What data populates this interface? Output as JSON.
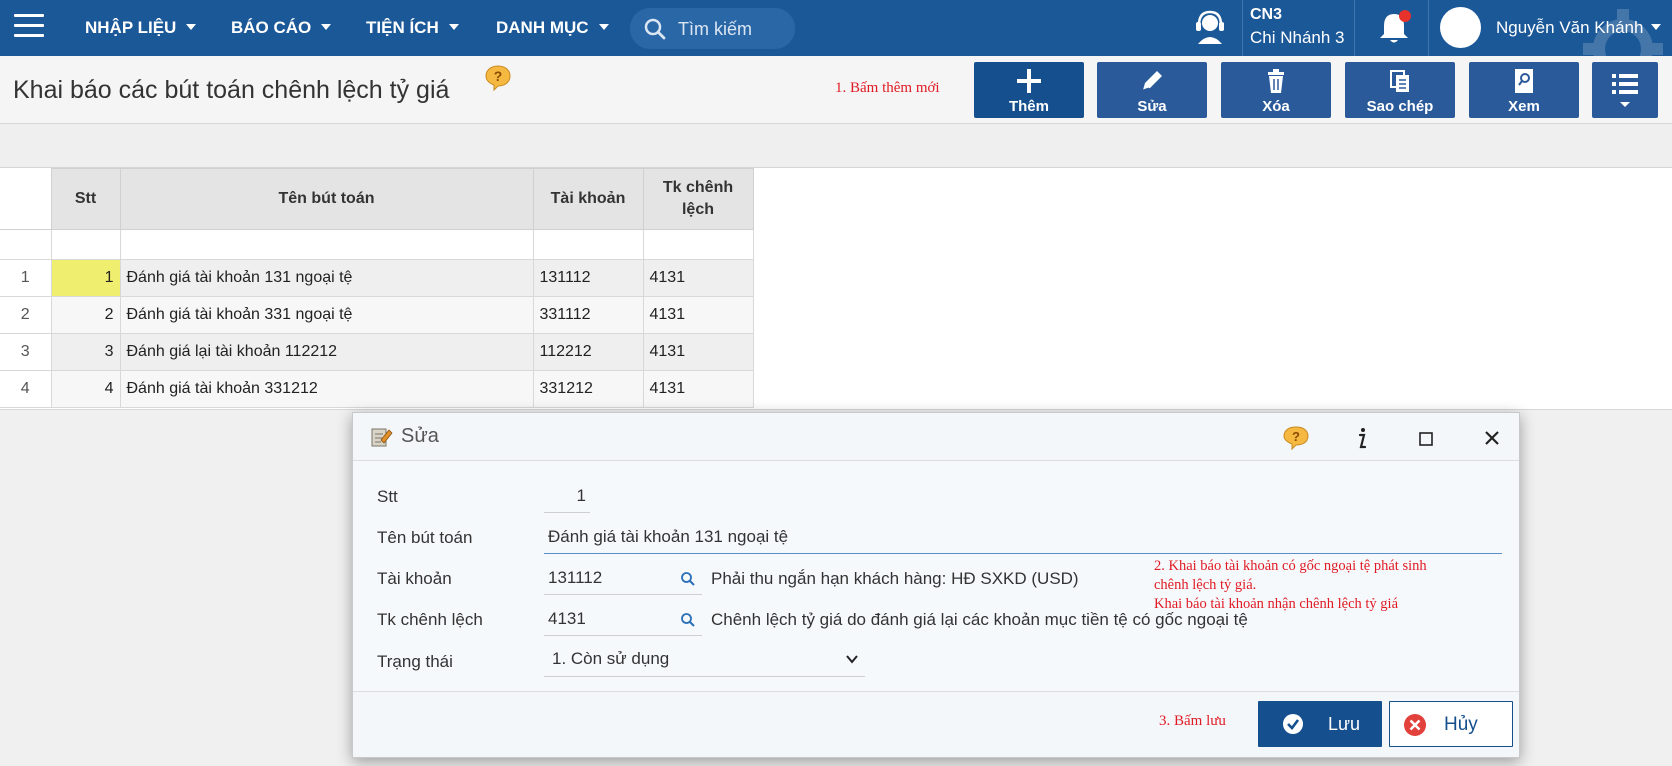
{
  "nav": {
    "menu": [
      {
        "label": "NHẬP LIỆU"
      },
      {
        "label": "BÁO CÁO"
      },
      {
        "label": "TIỆN ÍCH"
      },
      {
        "label": "DANH MỤC"
      }
    ],
    "search_placeholder": "Tìm kiếm",
    "branch_code": "CN3",
    "branch_name": "Chi Nhánh 3",
    "user_name": "Nguyễn Văn Khánh",
    "colors": {
      "bar": "#1b5898",
      "notification_dot": "#e8322c"
    }
  },
  "page": {
    "title": "Khai báo các bút toán chênh lệch tỷ giá"
  },
  "toolbar": {
    "annotation": "1. Bấm thêm mới",
    "add_label": "Thêm",
    "edit_label": "Sửa",
    "delete_label": "Xóa",
    "copy_label": "Sao chép",
    "view_label": "Xem"
  },
  "grid": {
    "headers": {
      "stt": "Stt",
      "name": "Tên bút toán",
      "account": "Tài khoản",
      "diff_account_line1": "Tk chênh",
      "diff_account_line2": "lệch"
    },
    "rows": [
      {
        "rownum": "1",
        "stt": "1",
        "name": "Đánh giá tài khoản 131 ngoại tệ",
        "account": "131112",
        "diff": "4131"
      },
      {
        "rownum": "2",
        "stt": "2",
        "name": "Đánh giá tài khoản 331 ngoại tệ",
        "account": "331112",
        "diff": "4131"
      },
      {
        "rownum": "3",
        "stt": "3",
        "name": "Đánh giá lại tài khoản 112212",
        "account": "112212",
        "diff": "4131"
      },
      {
        "rownum": "4",
        "stt": "4",
        "name": "Đánh giá tài khoản 331212",
        "account": "331212",
        "diff": "4131"
      }
    ],
    "selected_color": "#f0ee6e"
  },
  "dialog": {
    "title": "Sửa",
    "fields": {
      "stt_label": "Stt",
      "stt_value": "1",
      "name_label": "Tên bút toán",
      "name_value": "Đánh giá tài khoản 131 ngoại tệ",
      "account_label": "Tài khoản",
      "account_value": "131112",
      "account_desc": "Phải thu ngắn hạn khách hàng: HĐ SXKD (USD)",
      "diff_label": "Tk chênh lệch",
      "diff_value": "4131",
      "diff_desc": "Chênh lệch tỷ giá do đánh giá lại các khoản mục tiền tệ có gốc ngoại tệ",
      "status_label": "Trạng thái",
      "status_value": "1. Còn sử dụng"
    },
    "annotation_line1": "2. Khai báo tài khoản có gốc ngoại tệ phát sinh",
    "annotation_line2": "chênh lệch tỷ giá.",
    "annotation_line3": "Khai báo tài khoản nhận chênh lệch tỷ giá",
    "save_annotation": "3. Bấm lưu",
    "save_label": "Lưu",
    "cancel_label": "Hủy"
  }
}
